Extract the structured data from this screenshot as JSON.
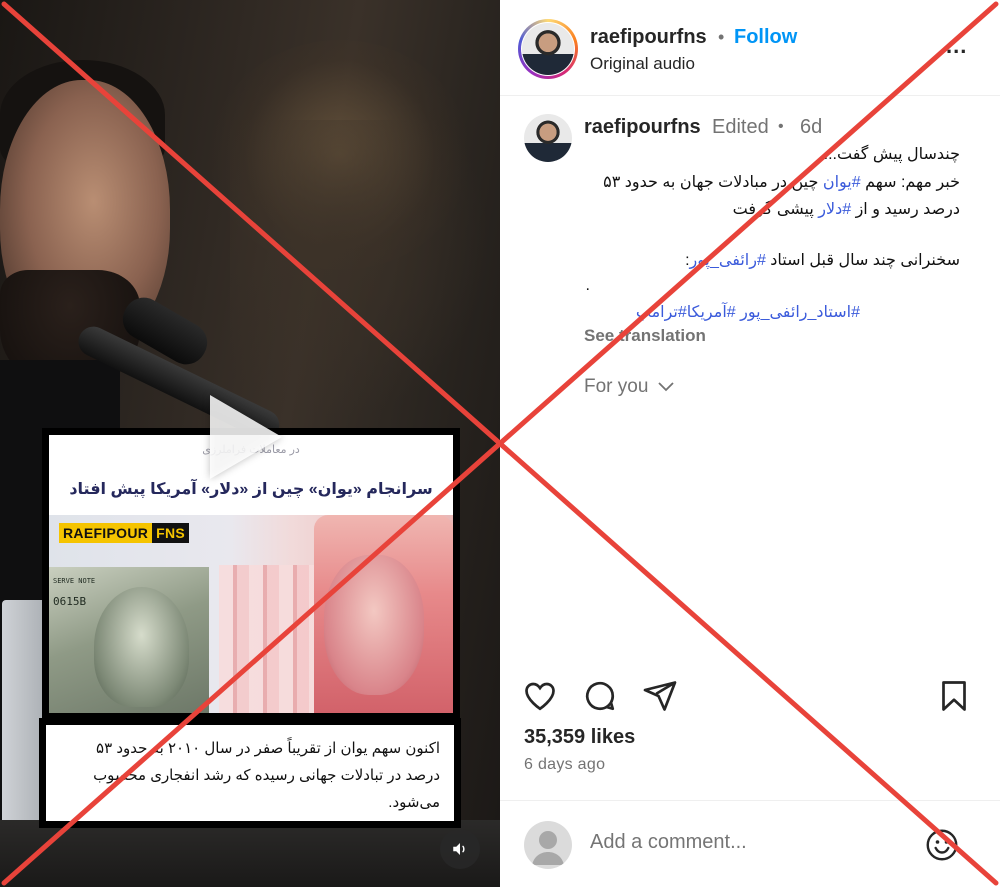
{
  "media": {
    "card": {
      "subheading": "در معاملات فراملرزی",
      "headline": "سرانجام «یوان» چین از «دلار» آمریکا پیش افتاد",
      "brand_part_a": "RAEFIPOUR",
      "brand_part_b": "FNS",
      "usd_serial": "0615B",
      "usd_reserve": "SERVE NOTE"
    },
    "caption": "اکنون سهم یوان از تقریباً صفر در سال ۲۰۱۰ به حدود ۵۳ درصد در تبادلات جهانی رسیده که رشد انفجاری محسوب می‌شود.",
    "play_icon": "play-icon",
    "sound_icon": "speaker-icon"
  },
  "header": {
    "username": "raefipourfns",
    "separator": "•",
    "follow_label": "Follow",
    "audio_label": "Original audio",
    "more_label": "..."
  },
  "post": {
    "username": "raefipourfns",
    "edited_label": "Edited",
    "separator": "•",
    "time": "6d",
    "line1": "چندسال پیش گفت...",
    "line2_prefix": "خبر مهم: سهم ",
    "line2_tag": "#یوان",
    "line2_suffix": " چین در مبادلات جهان به حدود ۵۳",
    "line3_prefix": "درصد رسید و از ",
    "line3_tag": "#دلار",
    "line3_suffix": " پیشی گرفت",
    "line4_prefix": "سخنرانی چند سال قبل استاد ",
    "line4_tag": "#رائفی_پور",
    "line4_suffix": ":",
    "line5": ".",
    "line6_tag1": "#استاد_رائفی_پور",
    "line6_tag2": "#آمریکا",
    "line6_tag3": "#ترامپ",
    "see_translation": "See translation",
    "for_you": "For you",
    "for_you_icon": "chevron-down-icon"
  },
  "actions": {
    "like_icon": "heart-icon",
    "comment_icon": "comment-icon",
    "share_icon": "send-icon",
    "save_icon": "bookmark-icon"
  },
  "stats": {
    "likes": "35,359 likes",
    "ago": "6 days ago"
  },
  "comment": {
    "placeholder": "Add a comment...",
    "emoji_icon": "emoji-icon"
  },
  "overlay": {
    "x_color": "#e8433a"
  },
  "colors": {
    "link": "#0095f6",
    "hashtag": "#3b5bdb",
    "muted": "#737373",
    "brand_yellow": "#f5c400"
  }
}
